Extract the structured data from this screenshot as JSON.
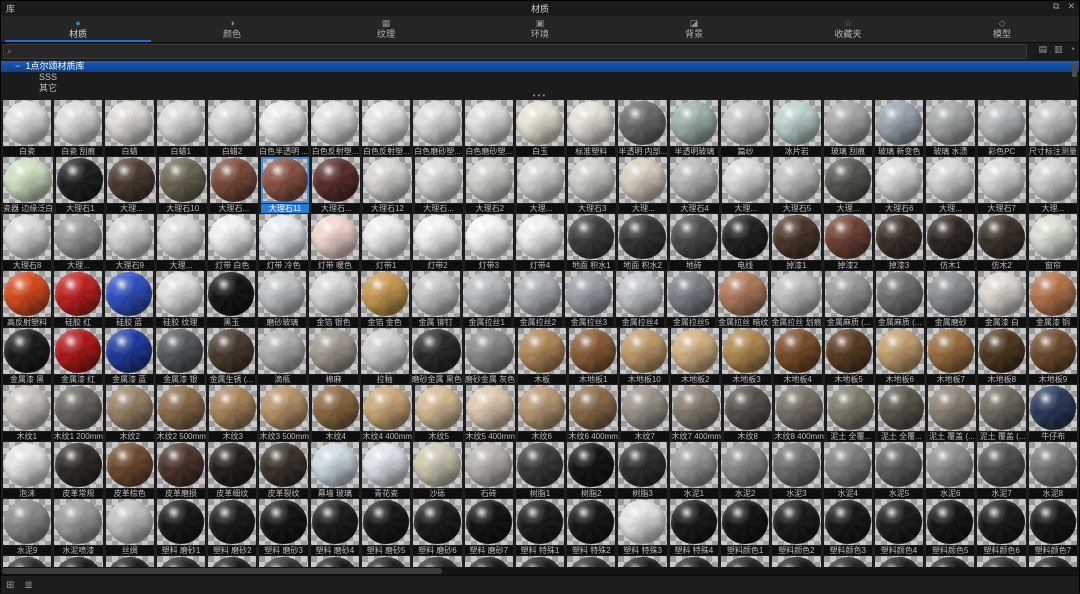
{
  "titlebar": {
    "panel_label": "库",
    "title": "材质",
    "float_icon": "⧉",
    "close_icon": "✕"
  },
  "tabs": [
    {
      "label": "材质",
      "icon_name": "material-sphere-icon",
      "glyph": "●",
      "active": true
    },
    {
      "label": "颜色",
      "icon_name": "color-icon",
      "glyph": "◑",
      "active": false
    },
    {
      "label": "纹理",
      "icon_name": "texture-icon",
      "glyph": "▦",
      "active": false
    },
    {
      "label": "环境",
      "icon_name": "environment-icon",
      "glyph": "▣",
      "active": false
    },
    {
      "label": "背景",
      "icon_name": "background-icon",
      "glyph": "◪",
      "active": false
    },
    {
      "label": "收藏夹",
      "icon_name": "favorites-star-icon",
      "glyph": "☆",
      "active": false
    },
    {
      "label": "模型",
      "icon_name": "model-cube-icon",
      "glyph": "◇",
      "active": false
    }
  ],
  "search": {
    "value": "",
    "placeholder": "",
    "icon": "⌕"
  },
  "toolbar": {
    "icons": [
      {
        "name": "new-folder-icon",
        "glyph": "▤"
      },
      {
        "name": "import-folder-icon",
        "glyph": "▥"
      },
      {
        "name": "settings-icon",
        "glyph": "◔"
      }
    ]
  },
  "tree": {
    "caret": "−",
    "root_label": "1点尔颂材质库",
    "children": [
      "SSS",
      "其它"
    ]
  },
  "splitter_dots": "•••",
  "colors": {
    "accent": "#1e6fd2",
    "selection": "#2b7ad2",
    "tree_selection": "#14509e"
  },
  "statusbar": {
    "icons": [
      {
        "name": "grid-view-icon",
        "glyph": "⊞"
      },
      {
        "name": "list-view-icon",
        "glyph": "≣"
      }
    ]
  },
  "grid": {
    "selected": {
      "row": 1,
      "col": 5
    },
    "rows": [
      {
        "cells": [
          {
            "n": "白瓷",
            "c": "#e2e2e0"
          },
          {
            "n": "白瓷 刮痕",
            "c": "#dededd"
          },
          {
            "n": "白蜡",
            "c": "#e0ddd8"
          },
          {
            "n": "白蜡1",
            "c": "#dcdcda"
          },
          {
            "n": "白蜡2",
            "c": "#d8d8d6"
          },
          {
            "n": "白色半透明 ...",
            "c": "#ececea"
          },
          {
            "n": "白色反射塑...",
            "c": "#e4e4e4"
          },
          {
            "n": "白色反射塑...",
            "c": "#e7e7e7"
          },
          {
            "n": "白色磨砂塑...",
            "c": "#dcdcdc"
          },
          {
            "n": "白色磨砂塑...",
            "c": "#e0e0e0"
          },
          {
            "n": "白玉",
            "c": "#e8e4d4"
          },
          {
            "n": "标准塑料",
            "c": "#e6e2da"
          },
          {
            "n": "半透明 内部...",
            "c": "#6a6a6a"
          },
          {
            "n": "半透明玻璃",
            "c": "#9fb3ae"
          },
          {
            "n": "篇纱",
            "c": "#c7c7c7"
          },
          {
            "n": "冰片岩",
            "c": "#bcd3cf"
          },
          {
            "n": "玻璃 刮痕",
            "c": "#a8a8a8"
          },
          {
            "n": "玻璃 新变色",
            "c": "#9aa5b0"
          },
          {
            "n": "玻璃 水渍",
            "c": "#a5a8a8"
          },
          {
            "n": "彩色PC",
            "c": "#b8bcbe"
          },
          {
            "n": "尺寸标注测量",
            "c": "#c5c5c5"
          }
        ]
      },
      {
        "cells": [
          {
            "n": "瓷器 边缘泛白",
            "c": "#cfe0c2"
          },
          {
            "n": "大理石1",
            "c": "#1f1f1f"
          },
          {
            "n": "大理...",
            "c": "#4a3a30"
          },
          {
            "n": "大理石10",
            "c": "#6b6653"
          },
          {
            "n": "大理石...",
            "c": "#7a4a3a"
          },
          {
            "n": "大理石11",
            "c": "#8a5242"
          },
          {
            "n": "大理石...",
            "c": "#5a2e2a"
          },
          {
            "n": "大理石12",
            "c": "#d8d6d2"
          },
          {
            "n": "大理石...",
            "c": "#dadada"
          },
          {
            "n": "大理石2",
            "c": "#cfcfcb"
          },
          {
            "n": "大理...",
            "c": "#d5d5d3"
          },
          {
            "n": "大理石3",
            "c": "#d0cec8"
          },
          {
            "n": "大理...",
            "c": "#d9cfc0"
          },
          {
            "n": "大理石4",
            "c": "#b9b9b7"
          },
          {
            "n": "大理...",
            "c": "#dcdcdc"
          },
          {
            "n": "大理石5",
            "c": "#c2c2c0"
          },
          {
            "n": "大理...",
            "c": "#55584e"
          },
          {
            "n": "大理石6",
            "c": "#dddddd"
          },
          {
            "n": "大理...",
            "c": "#d6d6d6"
          },
          {
            "n": "大理石7",
            "c": "#dadada"
          },
          {
            "n": "大理...",
            "c": "#d2d2d2"
          }
        ]
      },
      {
        "cells": [
          {
            "n": "大理石8",
            "c": "#dadada"
          },
          {
            "n": "大理...",
            "c": "#9a9a9a"
          },
          {
            "n": "大理石9",
            "c": "#d6d6d4"
          },
          {
            "n": "大理...",
            "c": "#dcdcdc"
          },
          {
            "n": "灯带 白色",
            "c": "#f2f2f0"
          },
          {
            "n": "灯带 冷色",
            "c": "#e8edf2"
          },
          {
            "n": "灯带 暖色",
            "c": "#f2d8cf"
          },
          {
            "n": "灯带1",
            "c": "#efefef"
          },
          {
            "n": "灯带2",
            "c": "#f4f4f2"
          },
          {
            "n": "灯带3",
            "c": "#f6f6f4"
          },
          {
            "n": "灯带4",
            "c": "#f0f0ee"
          },
          {
            "n": "地面 积水1",
            "c": "#3c3c3c"
          },
          {
            "n": "地面 积水2",
            "c": "#343434"
          },
          {
            "n": "地砖",
            "c": "#4a4a4a"
          },
          {
            "n": "电线",
            "c": "#202020"
          },
          {
            "n": "掉漆1",
            "c": "#4a3527"
          },
          {
            "n": "掉漆2",
            "c": "#6e4234"
          },
          {
            "n": "掉漆3",
            "c": "#3a3028"
          },
          {
            "n": "仿木1",
            "c": "#2e2620"
          },
          {
            "n": "仿木2",
            "c": "#3a3228"
          },
          {
            "n": "窗帘",
            "c": "#d9e0d4"
          }
        ]
      },
      {
        "cells": [
          {
            "n": "高反射塑料",
            "c": "#d84a1e"
          },
          {
            "n": "硅胶 红",
            "c": "#c22020"
          },
          {
            "n": "硅胶 蓝",
            "c": "#2f4fc2"
          },
          {
            "n": "硅胶 纹理",
            "c": "#e0e0e0"
          },
          {
            "n": "黑玉",
            "c": "#141414"
          },
          {
            "n": "磨砂玻璃",
            "c": "#c0c4c6"
          },
          {
            "n": "金箔 银色",
            "c": "#d8d8d6"
          },
          {
            "n": "金箔 金色",
            "c": "#c89a50"
          },
          {
            "n": "金属 铆钉",
            "c": "#c8c8c8"
          },
          {
            "n": "金属拉丝1",
            "c": "#b8bcc0"
          },
          {
            "n": "金属拉丝2",
            "c": "#aeb2b6"
          },
          {
            "n": "金属拉丝3",
            "c": "#9aa0a6"
          },
          {
            "n": "金属拉丝4",
            "c": "#c2c6ca"
          },
          {
            "n": "金属拉丝5",
            "c": "#7a8086"
          },
          {
            "n": "金属拉丝 暗纹",
            "c": "#b07a5a"
          },
          {
            "n": "金属拉丝 划痕",
            "c": "#c0c0c0"
          },
          {
            "n": "金属麻质 (...",
            "c": "#9a9a9a"
          },
          {
            "n": "金属麻质 (...",
            "c": "#6e6e6e"
          },
          {
            "n": "金属磨砂",
            "c": "#8a8e92"
          },
          {
            "n": "金属漆 白",
            "c": "#ddd8d0"
          },
          {
            "n": "金属漆 铜",
            "c": "#b5754a"
          }
        ]
      },
      {
        "cells": [
          {
            "n": "金属漆 黑",
            "c": "#1a1a1a"
          },
          {
            "n": "金属漆 红",
            "c": "#b01818"
          },
          {
            "n": "金属漆 蓝",
            "c": "#1e3a9e"
          },
          {
            "n": "金属漆 银",
            "c": "#55595d"
          },
          {
            "n": "金属生锈 (...",
            "c": "#4a3a2e"
          },
          {
            "n": "滴瓶",
            "c": "#b0b0ae"
          },
          {
            "n": "棉麻",
            "c": "#a09a90"
          },
          {
            "n": "拉釉",
            "c": "#d0d0ce"
          },
          {
            "n": "磨砂金属 黑色",
            "c": "#2a2a2a"
          },
          {
            "n": "磨砂金属 灰色",
            "c": "#8a8a8a"
          },
          {
            "n": "木板",
            "c": "#b08858"
          },
          {
            "n": "木地板1",
            "c": "#8a5c34"
          },
          {
            "n": "木地板10",
            "c": "#c09a6a"
          },
          {
            "n": "木地板2",
            "c": "#d4b284"
          },
          {
            "n": "木地板3",
            "c": "#b08850"
          },
          {
            "n": "木地板4",
            "c": "#7a4e2a"
          },
          {
            "n": "木地板5",
            "c": "#5a3c22"
          },
          {
            "n": "木地板6",
            "c": "#c4a070"
          },
          {
            "n": "木地板7",
            "c": "#9a6c3e"
          },
          {
            "n": "木地板8",
            "c": "#4e3820"
          },
          {
            "n": "木地板9",
            "c": "#6e4c2c"
          }
        ]
      },
      {
        "cells": [
          {
            "n": "木纹1",
            "c": "#c8c4bc"
          },
          {
            "n": "木纹1 200mm",
            "c": "#6a665e"
          },
          {
            "n": "木纹2",
            "c": "#9a8468"
          },
          {
            "n": "木纹2 500mm",
            "c": "#8a6c4a"
          },
          {
            "n": "木纹3",
            "c": "#a8845a"
          },
          {
            "n": "木纹3 500mm",
            "c": "#b89468"
          },
          {
            "n": "木纹4",
            "c": "#8a6840"
          },
          {
            "n": "木纹4 400mm",
            "c": "#caa878"
          },
          {
            "n": "木纹5",
            "c": "#d4bc94"
          },
          {
            "n": "木纹5 400mm",
            "c": "#decab0"
          },
          {
            "n": "木纹6",
            "c": "#b89a74"
          },
          {
            "n": "木纹6 400mm",
            "c": "#8a6a48"
          },
          {
            "n": "木纹7",
            "c": "#9a948a"
          },
          {
            "n": "木纹7 400mm",
            "c": "#847c6e"
          },
          {
            "n": "木纹8",
            "c": "#565048"
          },
          {
            "n": "木纹8 400mm",
            "c": "#767066"
          },
          {
            "n": "泥土 全覆...",
            "c": "#7e7a6a"
          },
          {
            "n": "泥土 全覆...",
            "c": "#5a564a"
          },
          {
            "n": "泥土 覆盖 (...",
            "c": "#8a8274"
          },
          {
            "n": "泥土 覆盖 (...",
            "c": "#6e6a5e"
          },
          {
            "n": "牛仔布",
            "c": "#2a3a5a"
          }
        ]
      },
      {
        "cells": [
          {
            "n": "泡沫",
            "c": "#e6e6e4"
          },
          {
            "n": "皮革常规",
            "c": "#2e2a26"
          },
          {
            "n": "皮革棕色",
            "c": "#6e4a2e"
          },
          {
            "n": "皮革磨损",
            "c": "#4a342a"
          },
          {
            "n": "皮革细纹",
            "c": "#241f1c"
          },
          {
            "n": "皮革裂纹",
            "c": "#3a322a"
          },
          {
            "n": "幕墙 玻璃",
            "c": "#cfdce4"
          },
          {
            "n": "青花瓷",
            "c": "#dde4ea"
          },
          {
            "n": "沙砾",
            "c": "#cdc9b2"
          },
          {
            "n": "石砖",
            "c": "#b8b4ac"
          },
          {
            "n": "树脂1",
            "c": "#3a3a38"
          },
          {
            "n": "树脂2",
            "c": "#141414"
          },
          {
            "n": "树脂3",
            "c": "#2e2e2e"
          },
          {
            "n": "水泥1",
            "c": "#9a9a98"
          },
          {
            "n": "水泥2",
            "c": "#8a8a88"
          },
          {
            "n": "水泥3",
            "c": "#6e6e6c"
          },
          {
            "n": "水泥4",
            "c": "#7e7e7c"
          },
          {
            "n": "水泥5",
            "c": "#5e5e5c"
          },
          {
            "n": "水泥6",
            "c": "#8e8e8c"
          },
          {
            "n": "水泥7",
            "c": "#4e4e4c"
          },
          {
            "n": "水泥8",
            "c": "#767674"
          }
        ]
      },
      {
        "cells": [
          {
            "n": "水泥9",
            "c": "#8a8a88"
          },
          {
            "n": "水泥喷漆",
            "c": "#9a9a98"
          },
          {
            "n": "丝绸",
            "c": "#c2c2c0"
          },
          {
            "n": "塑料 磨砂1",
            "c": "#17171a"
          },
          {
            "n": "塑料 磨砂2",
            "c": "#1a1a1d"
          },
          {
            "n": "塑料 磨砂3",
            "c": "#141417"
          },
          {
            "n": "塑料 磨砂4",
            "c": "#1c1c1f"
          },
          {
            "n": "塑料 磨砂5",
            "c": "#161619"
          },
          {
            "n": "塑料 磨砂6",
            "c": "#1a1a1d"
          },
          {
            "n": "塑料 磨砂7",
            "c": "#131316"
          },
          {
            "n": "塑料 特殊1",
            "c": "#1b1b1e"
          },
          {
            "n": "塑料 特殊2",
            "c": "#161619"
          },
          {
            "n": "塑料 特殊3",
            "c": "#e4e4e4"
          },
          {
            "n": "塑料 特殊4",
            "c": "#18181b"
          },
          {
            "n": "塑料颜色1",
            "c": "#141417"
          },
          {
            "n": "塑料颜色2",
            "c": "#1a1a1d"
          },
          {
            "n": "塑料颜色3",
            "c": "#17171a"
          },
          {
            "n": "塑料颜色4",
            "c": "#1c1c1f"
          },
          {
            "n": "塑料颜色5",
            "c": "#151518"
          },
          {
            "n": "塑料颜色6",
            "c": "#19191c"
          },
          {
            "n": "塑料颜色7",
            "c": "#161619"
          }
        ]
      }
    ],
    "partial_row": {
      "cells": [
        {
          "c": "#2a2a2a"
        },
        {
          "c": "#1a1a1a"
        },
        {
          "c": "#1c1c1c"
        },
        {
          "c": "#242424"
        },
        {
          "c": "#1a1a1a"
        },
        {
          "c": "#303030"
        },
        {
          "c": "#1a1a1a"
        },
        {
          "c": "#1e1e1e"
        },
        {
          "c": "#262626"
        },
        {
          "c": "#1a1a1a"
        },
        {
          "c": "#1c1c1c"
        },
        {
          "c": "#2a2a2a"
        },
        {
          "c": "#1a1a1a"
        },
        {
          "c": "#1e1e1e"
        },
        {
          "c": "#202020"
        },
        {
          "c": "#1a1a1a"
        },
        {
          "c": "#242424"
        },
        {
          "c": "#1c1c1c"
        },
        {
          "c": "#1a1a1a"
        },
        {
          "c": "#2a2a2a"
        },
        {
          "c": "#1e1e1e"
        }
      ]
    }
  }
}
